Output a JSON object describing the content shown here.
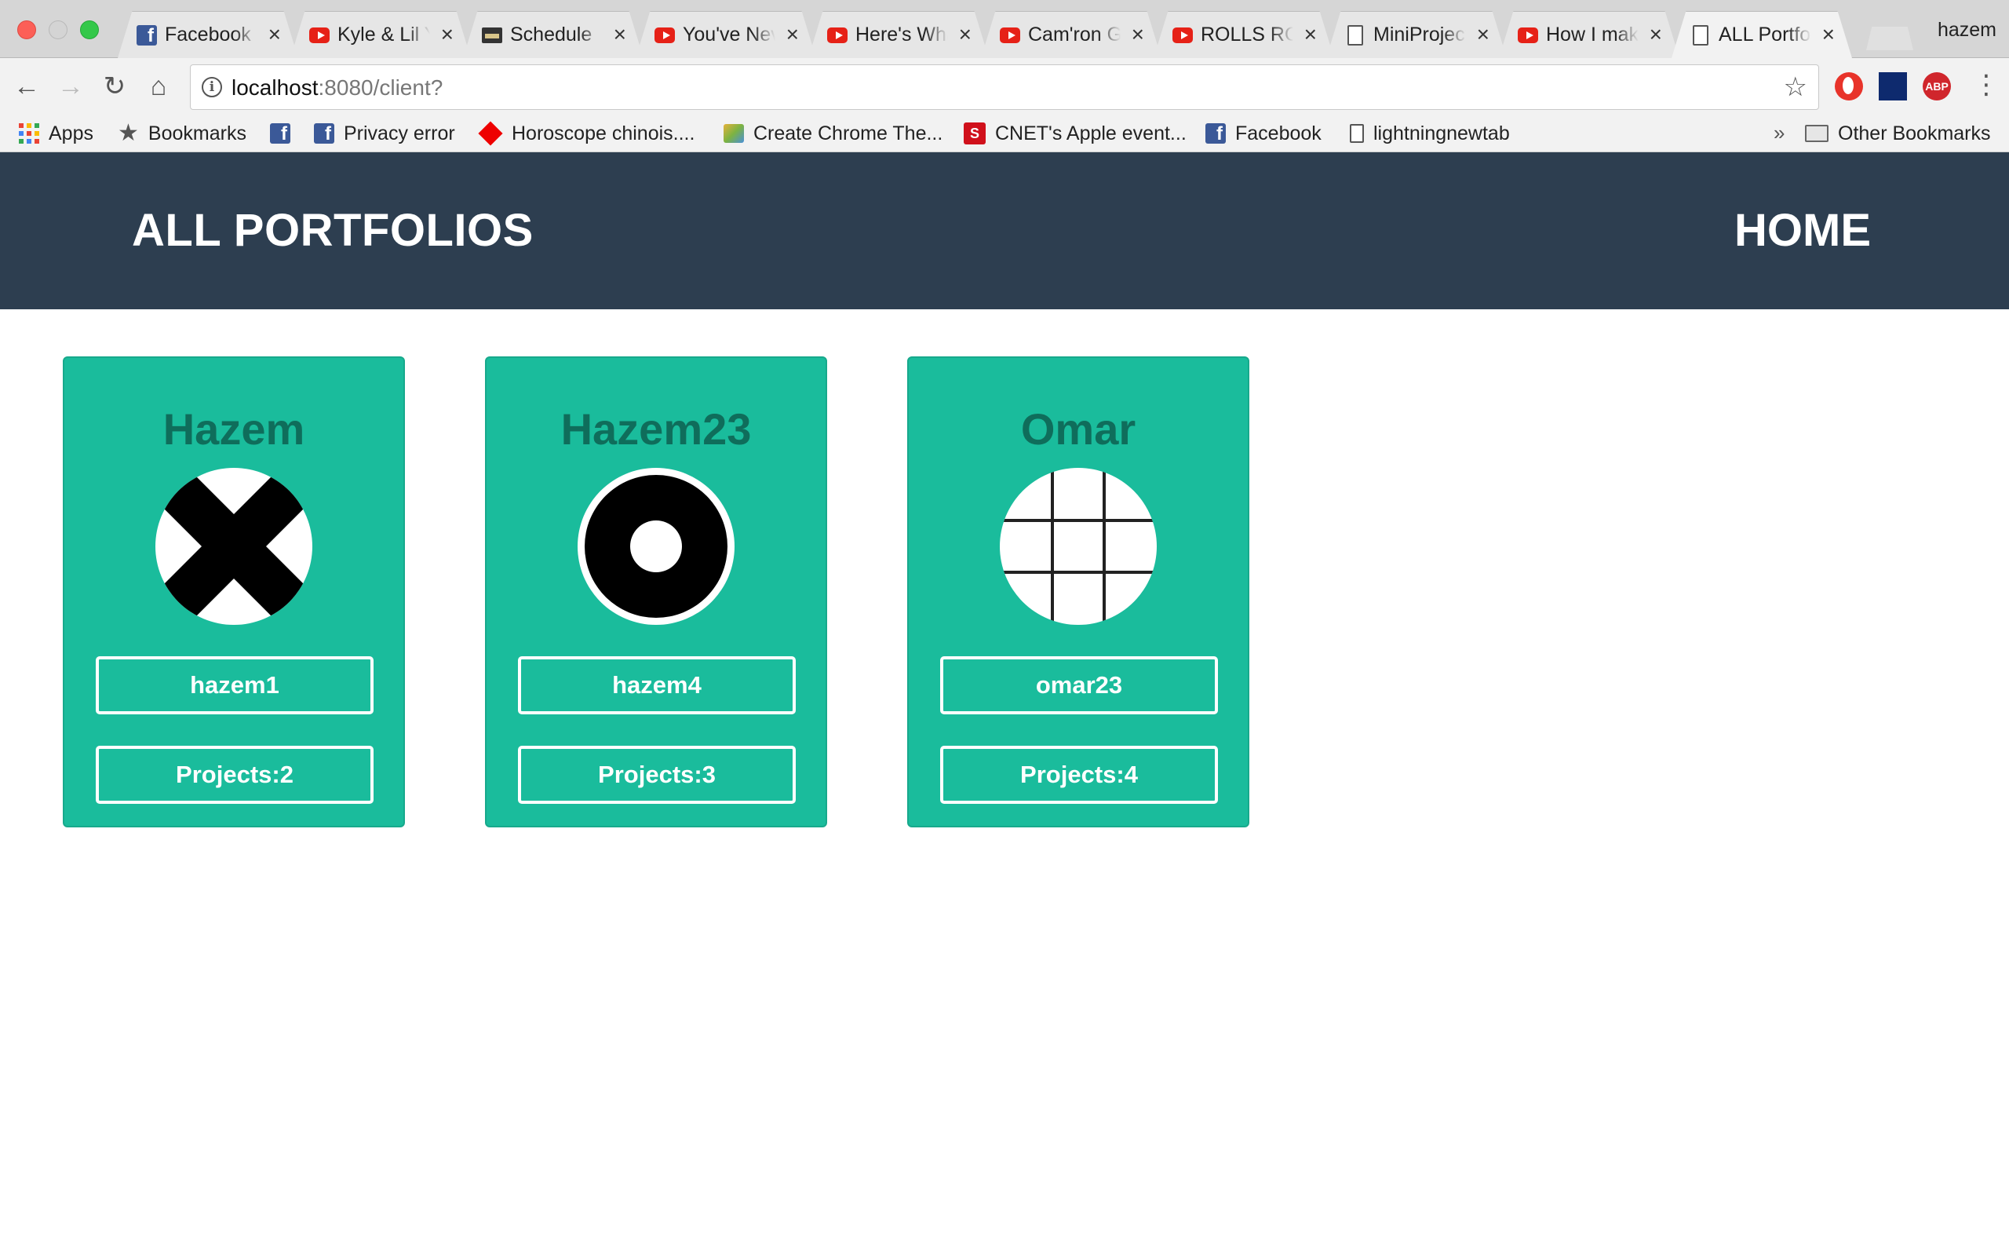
{
  "browser": {
    "tabs": [
      {
        "title": "Facebook",
        "icon": "facebook-icon",
        "active": false
      },
      {
        "title": "Kyle & Lil Yachty",
        "icon": "youtube-icon",
        "active": false
      },
      {
        "title": "Schedule",
        "icon": "schedule-icon",
        "active": false
      },
      {
        "title": "You've Never Seen",
        "icon": "youtube-icon",
        "active": false
      },
      {
        "title": "Here's What",
        "icon": "youtube-icon",
        "active": false
      },
      {
        "title": "Cam'ron Girl",
        "icon": "youtube-icon",
        "active": false
      },
      {
        "title": "ROLLS ROYCE",
        "icon": "youtube-icon",
        "active": false
      },
      {
        "title": "MiniProject",
        "icon": "document-icon",
        "active": false
      },
      {
        "title": "How I make",
        "icon": "youtube-icon",
        "active": false
      },
      {
        "title": "ALL Portfolios",
        "icon": "document-icon",
        "active": true
      }
    ],
    "tab_close_glyph": "×",
    "profile_name": "hazem",
    "address": {
      "host": "localhost",
      "rest": ":8080/client?"
    },
    "bookmarks": [
      {
        "label": "Apps",
        "icon": "apps-icon"
      },
      {
        "label": "Bookmarks",
        "icon": "star-icon"
      },
      {
        "label": "",
        "icon": "facebook-icon"
      },
      {
        "label": "Privacy error",
        "icon": "facebook-icon"
      },
      {
        "label": "Horoscope chinois....",
        "icon": "diamond-icon"
      },
      {
        "label": "Create Chrome The...",
        "icon": "paint-icon"
      },
      {
        "label": "CNET's Apple event...",
        "icon": "cnet-icon"
      },
      {
        "label": "Facebook",
        "icon": "facebook-icon"
      },
      {
        "label": "lightningnewtab",
        "icon": "document-icon"
      }
    ],
    "bookmarks_overflow": "»",
    "other_bookmarks": "Other Bookmarks"
  },
  "header": {
    "title": "ALL PORTFOLIOS",
    "home_label": "HOME"
  },
  "colors": {
    "header_bg": "#2d3e50",
    "card_bg": "#1abc9c",
    "card_name": "#0f6d5b"
  },
  "portfolios": [
    {
      "name": "Hazem",
      "username": "hazem1",
      "projects_label": "Projects:2",
      "avatar": "x-cross-avatar-icon"
    },
    {
      "name": "Hazem23",
      "username": "hazem4",
      "projects_label": "Projects:3",
      "avatar": "ring-avatar-icon"
    },
    {
      "name": "Omar",
      "username": "omar23",
      "projects_label": "Projects:4",
      "avatar": "grid-avatar-icon"
    }
  ]
}
